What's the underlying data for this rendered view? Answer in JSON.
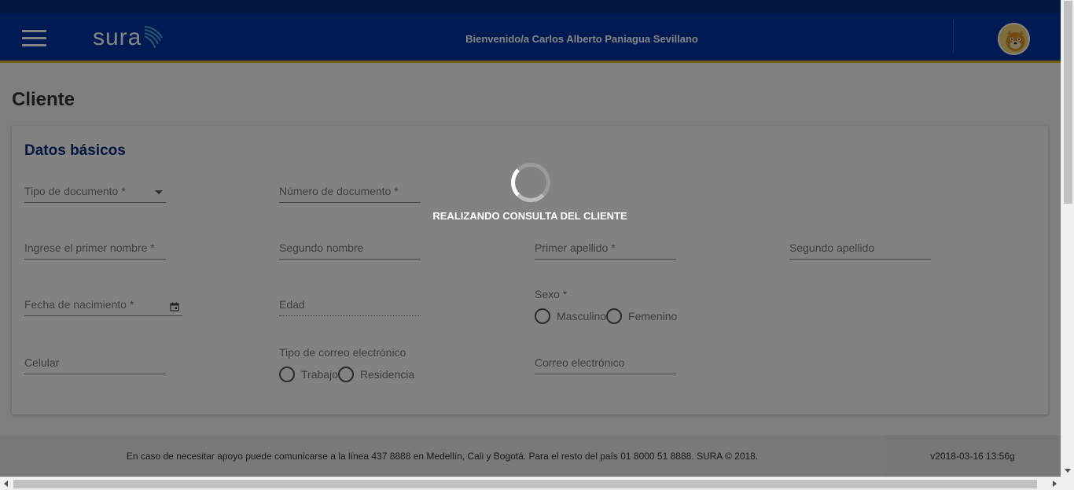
{
  "header": {
    "logo_text": "sura",
    "welcome": "Bienvenido/a Carlos Alberto Paniagua Sevillano"
  },
  "page": {
    "title": "Cliente"
  },
  "form": {
    "section_title": "Datos básicos",
    "tipo_documento": "Tipo de documento *",
    "numero_documento": "Número de documento *",
    "primer_nombre": "Ingrese el primer nombre *",
    "segundo_nombre": "Segundo nombre",
    "primer_apellido": "Primer apellido *",
    "segundo_apellido": "Segundo apellido",
    "fecha_nacimiento": "Fecha de nacimiento *",
    "edad": "Edad",
    "sexo": {
      "label": "Sexo *",
      "options": [
        "Masculino",
        "Femenino"
      ]
    },
    "celular": "Celular",
    "tipo_correo": {
      "label": "Tipo de correo electrónico",
      "options": [
        "Trabajo",
        "Residencia"
      ]
    },
    "correo": "Correo electrónico"
  },
  "footer": {
    "support_text": "En caso de necesitar apoyo puede comunicarse a la línea 437 8888 en Medellín, Cali y Bogotá. Para el resto del país 01 8000 51 8888. SURA © 2018.",
    "version": "v2018-03-16 13:56g"
  },
  "loading": {
    "message": "REALIZANDO CONSULTA DEL CLIENTE"
  },
  "colors": {
    "brand_blue": "#0033a0",
    "accent_yellow": "#e3b505",
    "section_title": "#0d2a7a"
  },
  "icons": {
    "menu": "hamburger-menu-icon",
    "calendar": "calendar-icon",
    "dropdown": "dropdown-arrow-icon",
    "spinner": "loading-spinner-icon"
  }
}
